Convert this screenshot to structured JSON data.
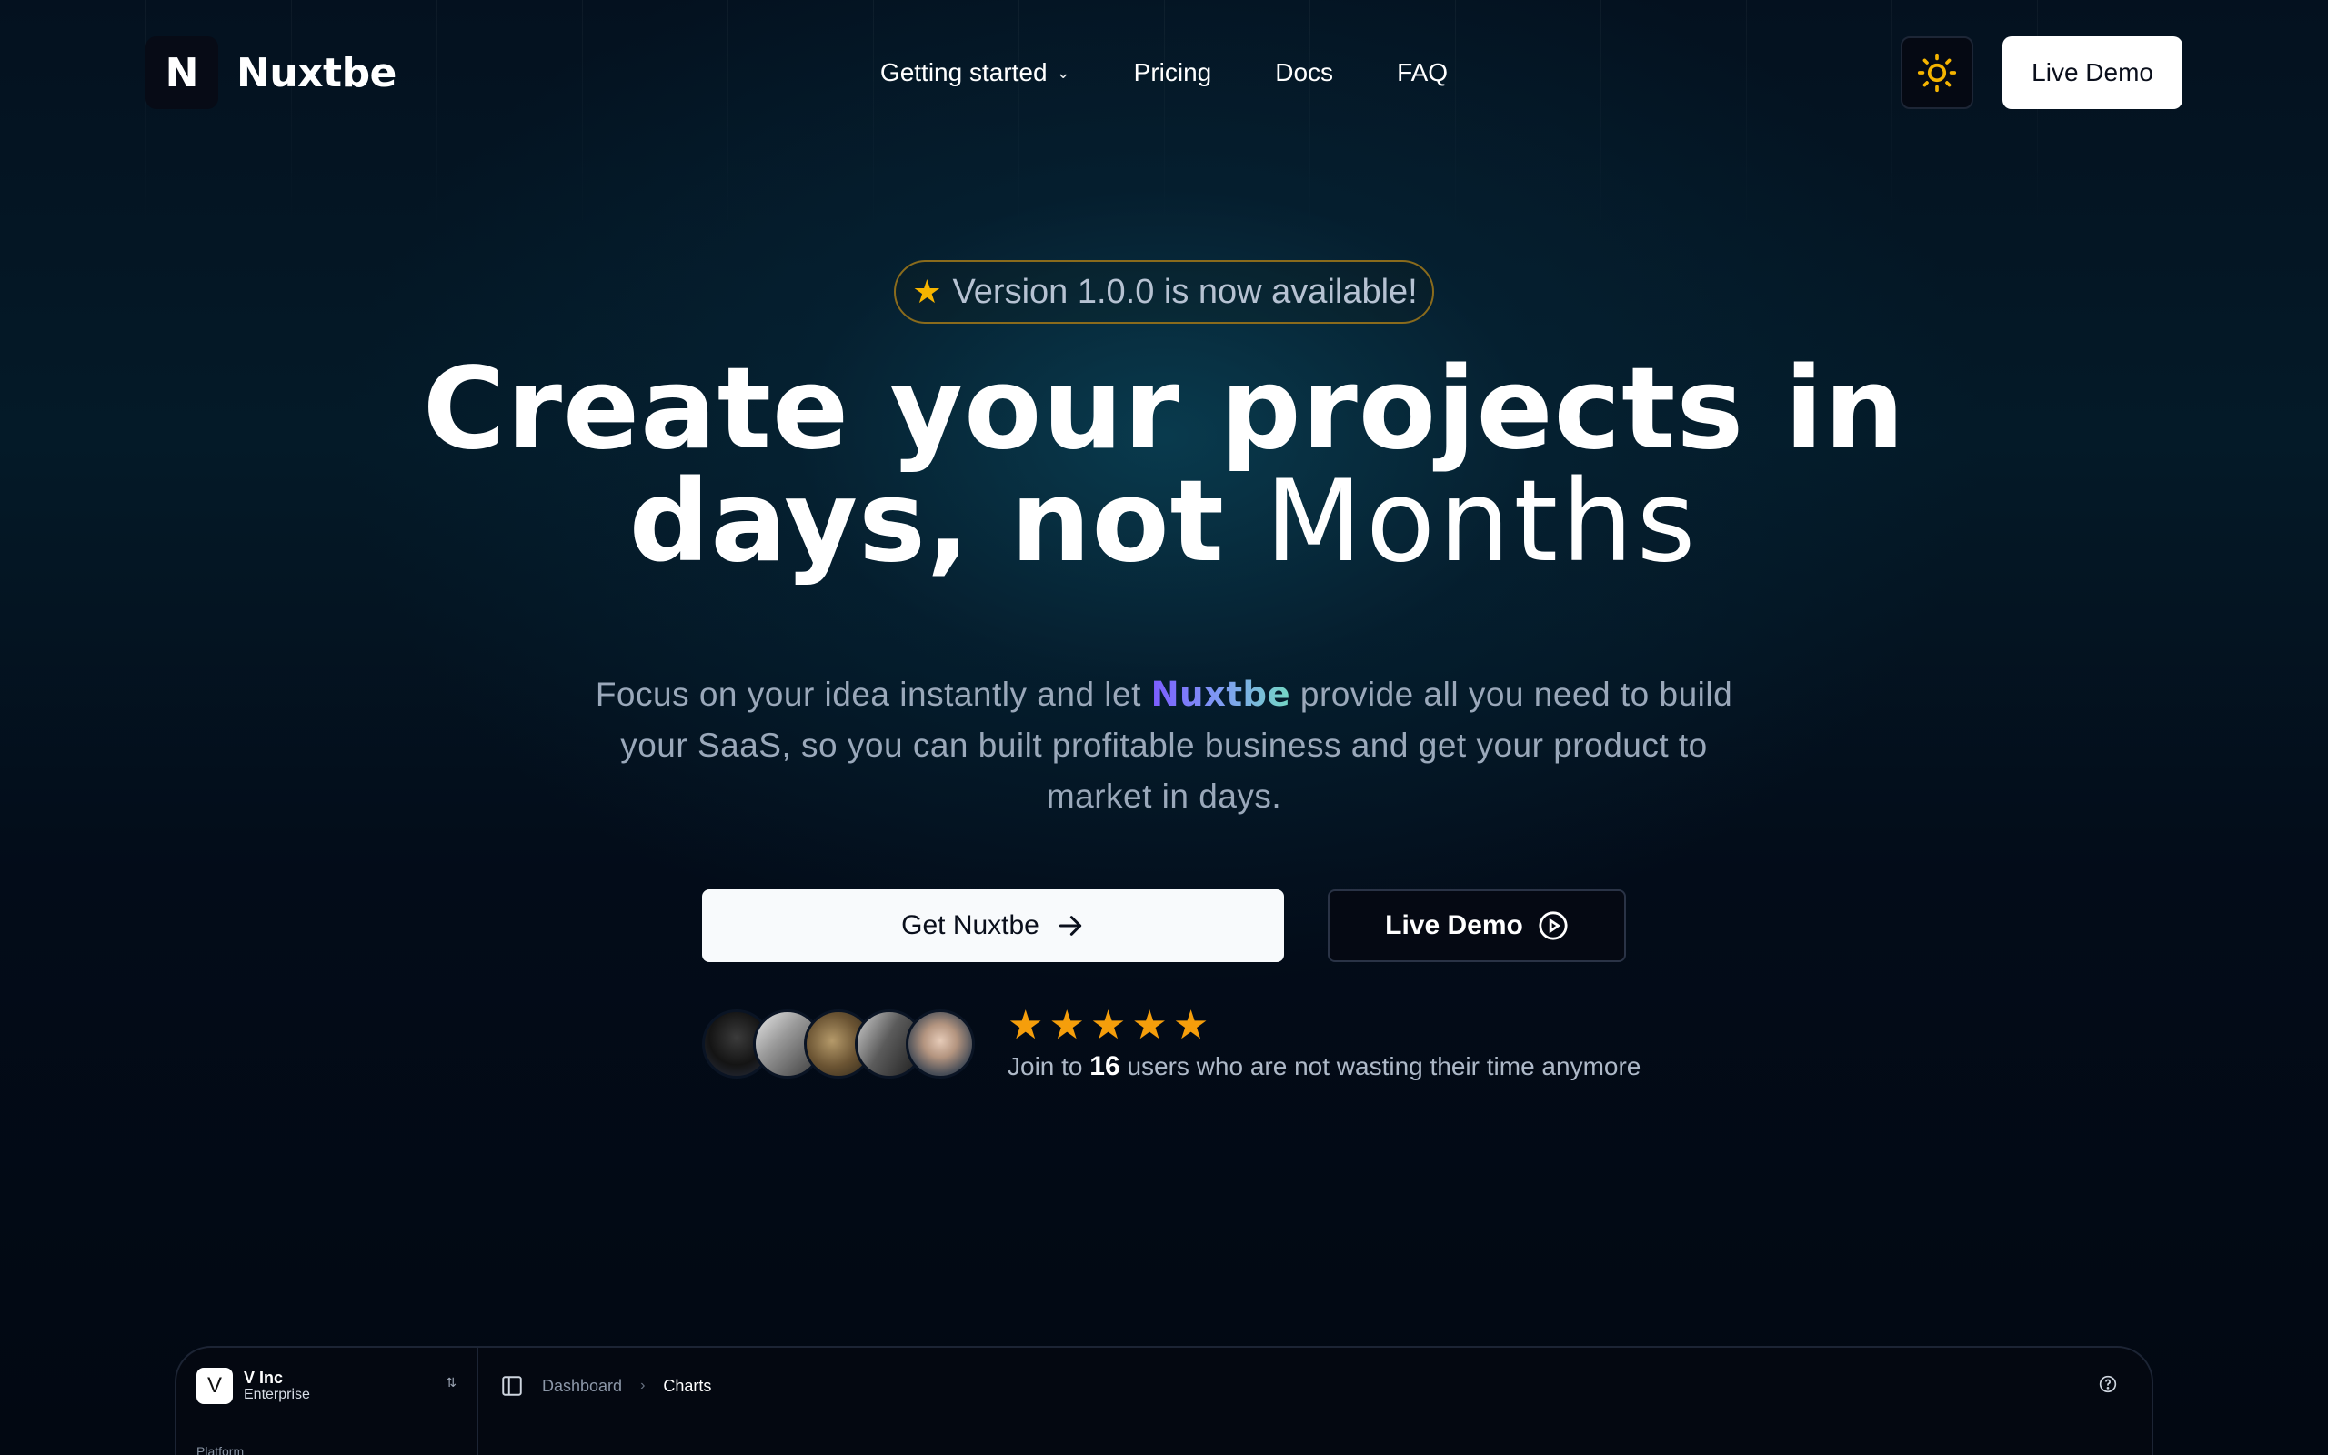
{
  "brand": {
    "logo_letter": "N",
    "name": "Nuxtbe"
  },
  "nav": {
    "links": [
      {
        "label": "Getting started",
        "has_dropdown": true
      },
      {
        "label": "Pricing"
      },
      {
        "label": "Docs"
      },
      {
        "label": "FAQ"
      }
    ],
    "theme_icon": "sun-icon",
    "live_demo_label": "Live Demo"
  },
  "hero": {
    "badge": "Version 1.0.0 is now available!",
    "headline_line1": "Create your projects in",
    "headline_line2_a": "days, not",
    "headline_line2_b": "Months",
    "sub_before": "Focus on your idea instantly and let",
    "sub_brand": "Nuxtbe",
    "sub_after": "provide all you need to build your SaaS, so you can built profitable business and get your product to market in days."
  },
  "cta": {
    "primary_label": "Get Nuxtbe",
    "secondary_label": "Live Demo"
  },
  "social_proof": {
    "rating": 5,
    "text_before": "Join to",
    "count": "16",
    "text_after": "users who are not wasting their time anymore",
    "avatar_count": 5
  },
  "preview": {
    "org_logo": "V",
    "org_name": "V Inc",
    "org_plan": "Enterprise",
    "section_label": "Platform",
    "breadcrumb": [
      "Dashboard",
      "Charts"
    ]
  },
  "colors": {
    "accent_star": "#f59e0b",
    "badge_border": "#8a6b1c",
    "brand_gradient": [
      "#7b5cff",
      "#74d7c4"
    ]
  }
}
